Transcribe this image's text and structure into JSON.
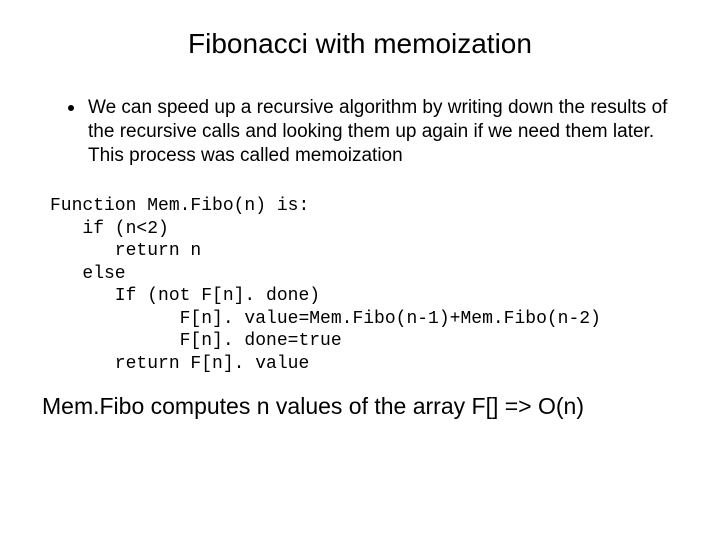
{
  "title": "Fibonacci with  memoization",
  "bullet": "We can speed up a recursive algorithm by writing down the results of the recursive calls and looking them up again if we need them later. This process was called memoization",
  "code": {
    "l1": "Function Mem.Fibo(n) is:",
    "l2": "   if (n<2)",
    "l3": "      return n",
    "l4": "   else",
    "l5": "      If (not F[n]. done)",
    "l6": "            F[n]. value=Mem.Fibo(n-1)+Mem.Fibo(n-2)",
    "l7": "            F[n]. done=true",
    "l8": "      return F[n]. value"
  },
  "footer": "Mem.Fibo computes n values of the array F[] => O(n)"
}
